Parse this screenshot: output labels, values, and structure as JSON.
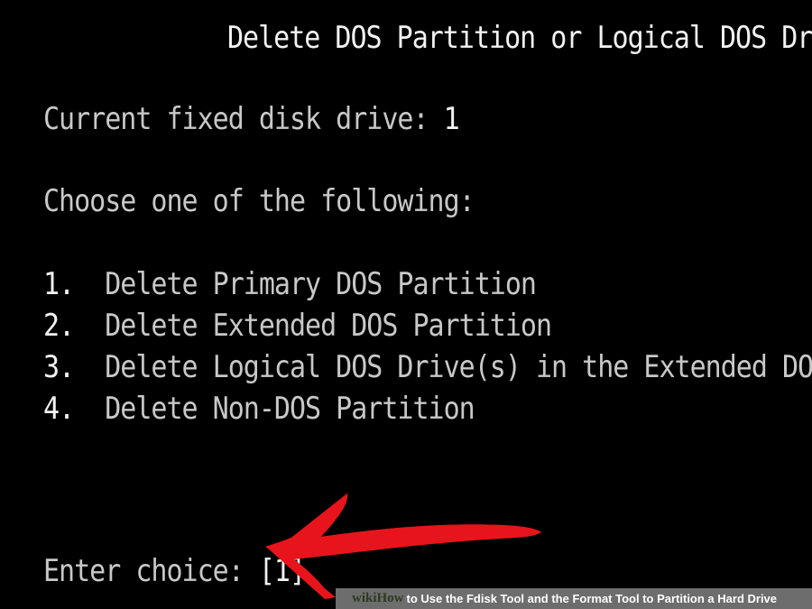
{
  "screen": {
    "title": "Delete DOS Partition or Logical DOS Drive",
    "drive_label": "Current fixed disk drive: ",
    "drive_value": "1",
    "prompt": "Choose one of the following:",
    "options": [
      {
        "number": "1.",
        "label": "Delete Primary DOS Partition"
      },
      {
        "number": "2.",
        "label": "Delete Extended DOS Partition"
      },
      {
        "number": "3.",
        "label": "Delete Logical DOS Drive(s) in the Extended DOS Partition"
      },
      {
        "number": "4.",
        "label": "Delete Non-DOS Partition"
      }
    ],
    "enter_label": "Enter choice: ",
    "enter_value": "[1]"
  },
  "annotation": {
    "arrow_color": "#e8141b",
    "icon": "red-arrow-icon"
  },
  "watermark": {
    "brand_wiki": "wiki",
    "brand_how": "How",
    "caption": "to Use the Fdisk Tool and the Format Tool to Partition a Hard Drive"
  }
}
